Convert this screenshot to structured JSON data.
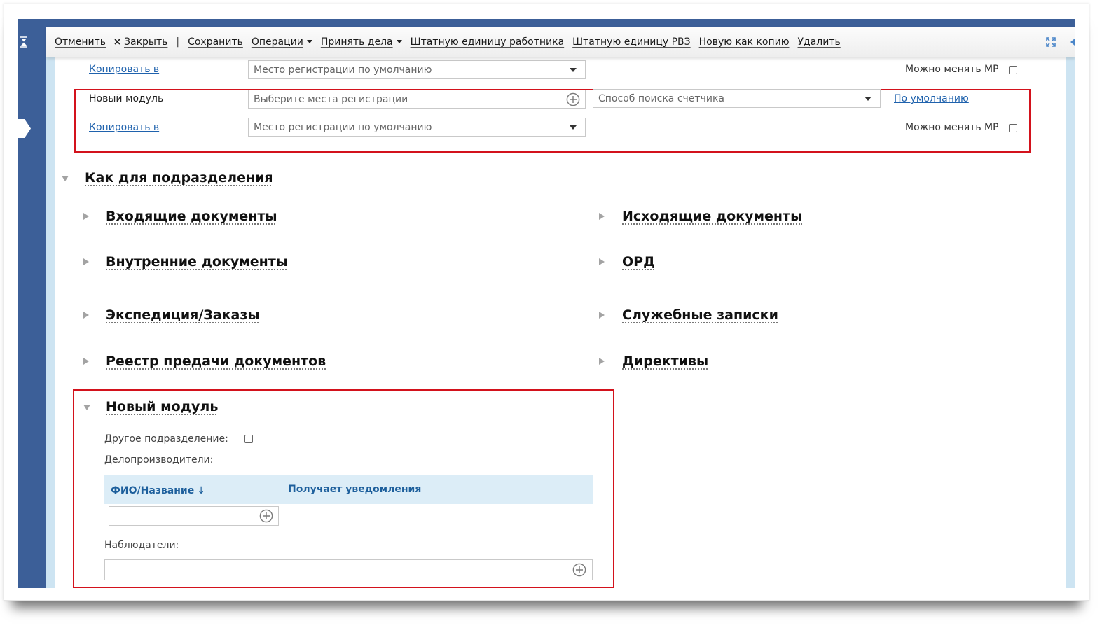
{
  "toolbar": {
    "cancel": "Отменить",
    "close": "Закрыть",
    "separator": "|",
    "save": "Сохранить",
    "operations": "Операции",
    "accept_cases": "Принять дела",
    "staff_unit_employee": "Штатную единицу работника",
    "staff_unit_rvz": "Штатную единицу РВЗ",
    "new_as_copy": "Новую как копию",
    "delete": "Удалить",
    "icons": {
      "close": "close-icon",
      "dropdown": "caret-down-icon",
      "fullscreen": "fullscreen-icon",
      "panel_toggle": "arrow-left-icon"
    }
  },
  "sidebar": {
    "icons": [
      "collapse-sidebar-icon",
      "sidebar-tab-arrow-icon"
    ]
  },
  "registration_rows": [
    {
      "link": "Копировать в",
      "place": "Место регистрации по умолчанию",
      "can_change_label": "Можно менять МР",
      "can_change_checked": false
    },
    {
      "label": "Новый модуль",
      "places_placeholder": "Выберите места регистрации",
      "counter_search": "Способ поиска счетчика",
      "default_link": "По умолчанию"
    },
    {
      "link": "Копировать в",
      "place": "Место регистрации по умолчанию",
      "can_change_label": "Можно менять МР",
      "can_change_checked": false
    }
  ],
  "department_section": {
    "title": "Как для подразделения",
    "expanded": true,
    "subsections": [
      {
        "title": "Входящие документы",
        "expanded": false
      },
      {
        "title": "Исходящие документы",
        "expanded": false
      },
      {
        "title": "Внутренние документы",
        "expanded": false
      },
      {
        "title": "ОРД",
        "expanded": false
      },
      {
        "title": "Экспедиция/Заказы",
        "expanded": false
      },
      {
        "title": "Служебные записки",
        "expanded": false
      },
      {
        "title": "Реестр предачи документов",
        "expanded": false
      },
      {
        "title": "Директивы",
        "expanded": false
      }
    ]
  },
  "new_module_section": {
    "title": "Новый модуль",
    "expanded": true,
    "other_department_label": "Другое подразделение:",
    "other_department_checked": false,
    "clerks_label": "Делопроизводители:",
    "clerks_table": {
      "columns": [
        {
          "label": "ФИО/Название",
          "sort_indicator": "↓"
        },
        {
          "label": "Получает уведомления"
        }
      ]
    },
    "observers_label": "Наблюдатели:"
  },
  "colors": {
    "sidebar": "#3c5f98",
    "link": "#1f62ad",
    "highlight_border": "#d3121c",
    "table_header_bg": "#dcedf7",
    "table_header_text": "#1d5f9c",
    "side_strip": "#cde4f2",
    "accent_icon": "#4b86c9"
  }
}
